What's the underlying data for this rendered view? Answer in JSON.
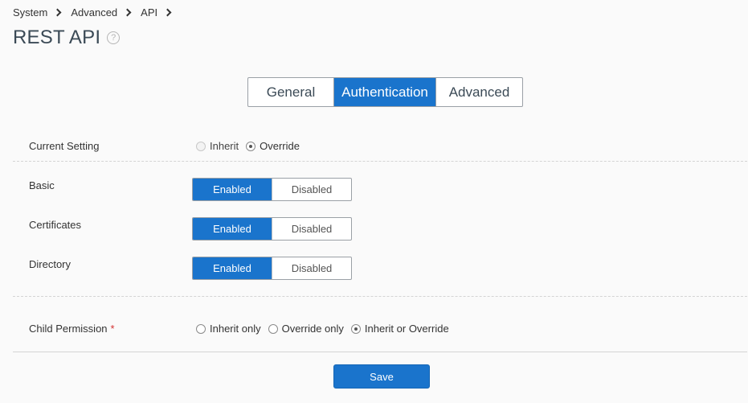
{
  "breadcrumb": [
    "System",
    "Advanced",
    "API"
  ],
  "page": {
    "title": "REST API",
    "help_glyph": "?"
  },
  "tabs": [
    {
      "label": "General",
      "active": false
    },
    {
      "label": "Authentication",
      "active": true
    },
    {
      "label": "Advanced",
      "active": false
    }
  ],
  "current_setting": {
    "label": "Current Setting",
    "options": [
      {
        "label": "Inherit",
        "checked": false,
        "disabled": true
      },
      {
        "label": "Override",
        "checked": true,
        "disabled": false
      }
    ]
  },
  "auth_methods": [
    {
      "label": "Basic",
      "enabled_label": "Enabled",
      "disabled_label": "Disabled",
      "value": "Enabled"
    },
    {
      "label": "Certificates",
      "enabled_label": "Enabled",
      "disabled_label": "Disabled",
      "value": "Enabled"
    },
    {
      "label": "Directory",
      "enabled_label": "Enabled",
      "disabled_label": "Disabled",
      "value": "Enabled"
    }
  ],
  "child_permission": {
    "label": "Child Permission",
    "required_mark": "*",
    "options": [
      {
        "label": "Inherit only",
        "checked": false
      },
      {
        "label": "Override only",
        "checked": false
      },
      {
        "label": "Inherit or Override",
        "checked": true
      }
    ]
  },
  "actions": {
    "save_label": "Save"
  },
  "colors": {
    "accent": "#1a74cc",
    "title": "#3b4a56",
    "required": "#d32f2f"
  }
}
